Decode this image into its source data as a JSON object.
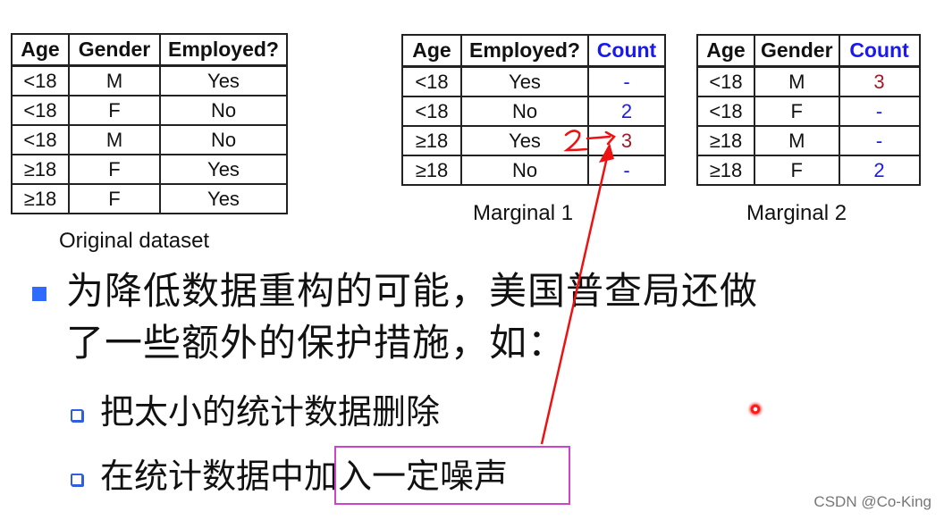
{
  "original_table": {
    "headers": [
      "Age",
      "Gender",
      "Employed?"
    ],
    "rows": [
      [
        "<18",
        "M",
        "Yes"
      ],
      [
        "<18",
        "F",
        "No"
      ],
      [
        "<18",
        "M",
        "No"
      ],
      [
        "≥18",
        "F",
        "Yes"
      ],
      [
        "≥18",
        "F",
        "Yes"
      ]
    ],
    "caption": "Original dataset"
  },
  "marginal1": {
    "headers": [
      "Age",
      "Employed?",
      "Count"
    ],
    "rows": [
      [
        "<18",
        "Yes",
        "-"
      ],
      [
        "<18",
        "No",
        "2"
      ],
      [
        "≥18",
        "Yes",
        "3"
      ],
      [
        "≥18",
        "No",
        "-"
      ]
    ],
    "caption": "Marginal 1",
    "handwritten_note": "2→"
  },
  "marginal2": {
    "headers": [
      "Age",
      "Gender",
      "Count"
    ],
    "rows": [
      [
        "<18",
        "M",
        "3"
      ],
      [
        "<18",
        "F",
        "-"
      ],
      [
        "≥18",
        "M",
        "-"
      ],
      [
        "≥18",
        "F",
        "2"
      ]
    ],
    "caption": "Marginal 2"
  },
  "main_bullet": {
    "line1": "为降低数据重构的可能，美国普查局还做",
    "line2": "了一些额外的保护措施，如："
  },
  "sub_bullets": [
    {
      "text": "把太小的统计数据删除"
    },
    {
      "text_prefix": "在统计数据中",
      "text_highlight": "加入一定噪声"
    }
  ],
  "colors": {
    "count_header": "#1a1aee",
    "count_blue": "#1a1aee",
    "count_red": "#a01a2a",
    "bullet": "#2f6bff",
    "annotation": "#ee1111",
    "highlight_box": "#cc44cc"
  },
  "watermark": "CSDN @Co-King"
}
